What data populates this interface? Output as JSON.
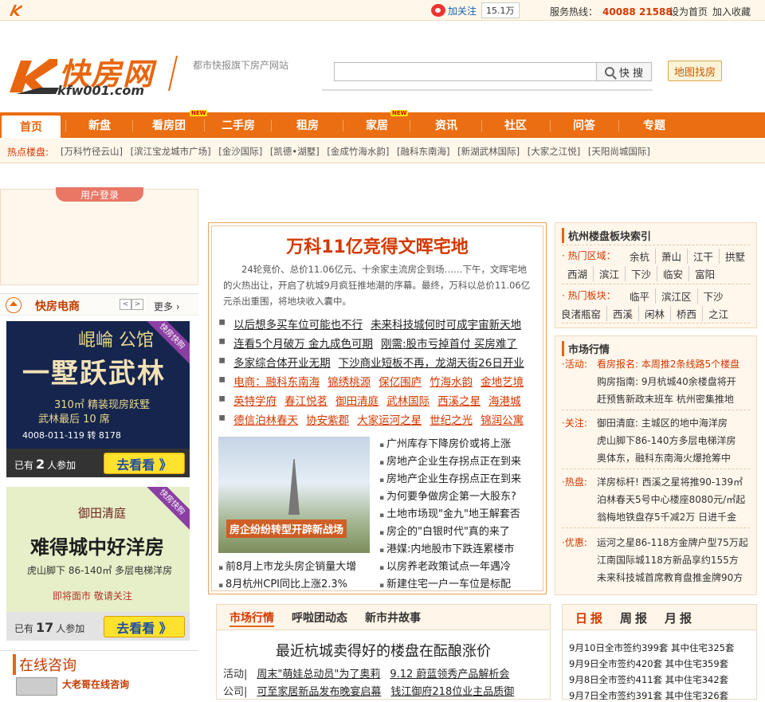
{
  "topbar": {
    "follow_label": "加关注",
    "follow_count": "15.1万",
    "hotline_label": "服务热线：",
    "hotline_number": "40088 21588",
    "home_link": "设为首页",
    "fav_link": "加入收藏"
  },
  "header": {
    "logo_cn": "快房网",
    "logo_en": "kfw001.com",
    "tagline": "都市快报旗下房产网站",
    "search_placeholder": "",
    "search_button": "快 搜",
    "map_button": "地图找房"
  },
  "nav": {
    "items": [
      "首页",
      "新盘",
      "看房团",
      "二手房",
      "租房",
      "家居",
      "资讯",
      "社区",
      "问答",
      "专题"
    ],
    "new_badge": "NEW"
  },
  "hotbar": {
    "label": "热点楼盘:",
    "items": [
      "[万科竹径云山]",
      "[滨江宝龙城市广场]",
      "[金沙国际]",
      "[凯德•湖墅]",
      "[金成竹海水韵]",
      "[融科东南海]",
      "[新湖武林国际]",
      "[大家之江悦]",
      "[天阳尚城国际]"
    ]
  },
  "left": {
    "login_tab": "用户登录",
    "ec_title": "快房电商",
    "ec_prev": "<",
    "ec_next": ">",
    "ec_more": "更多 ›",
    "ad1": {
      "ribbon": "快房快购",
      "t1": "崐崘 公馆",
      "t2": "一墅跃武林",
      "t3": "310㎡ 精装现房跃墅",
      "t4": "武林最后 10 席",
      "t5": "4008-011-119 转 8178",
      "joined_pre": "已有",
      "joined_num": "2",
      "joined_post": "人参加",
      "go": "去看看 》"
    },
    "ad2": {
      "ribbon": "快房快购",
      "t1": "御田清庭",
      "t2": "难得城中好洋房",
      "t3": "虎山脚下 86-140㎡ 多层电梯洋房",
      "t4": "即将面市  敬请关注",
      "joined_pre": "已有",
      "joined_num": "17",
      "joined_post": "人参加",
      "go": "去看看 》"
    },
    "consult_title": "在线咨询",
    "consult_sub": "大老哥在线咨询"
  },
  "featured": {
    "headline": "万科11亿竞得文晖宅地",
    "summary": "24轮竞价、总价11.06亿元、十余家主流房企到场……下午，文晖宅地的火热出让，开启了杭城9月疯狂推地潮的序幕。最终，万科以总价11.06亿元杀出重围，将地块收入囊中。",
    "lines": [
      [
        "以后想多买车位可能也不行",
        "未来科技城何时可成宇宙新天地"
      ],
      [
        "连看5个月破万 金九成色可期",
        "刚需:股市亏掉首付 买房难了"
      ],
      [
        "多家综合体开业无期",
        "下沙商业短板不再，龙湖天街26日开业"
      ]
    ],
    "red_lines": [
      [
        "电商：融科东南海",
        "锦绣桃源",
        "保亿围庐",
        "竹海水韵",
        "金地艺境"
      ],
      [
        "英特学府",
        "春江悦茗",
        "御田清庭",
        "武林国际",
        "西溪之星",
        "海港城"
      ],
      [
        "德信泊林春天",
        "协安紫郡",
        "大家运河之星",
        "世纪之光",
        "锦润公寓"
      ]
    ],
    "photo_caption": "房企纷纷转型开辟新战场",
    "right_news": [
      "广州库存下降房价或将上涨",
      "房地产企业生存拐点正在到来",
      "房地产企业生存拐点正在到来",
      "为何要争做房企第一大股东?",
      "土地市场现\"金九\"地王解套否",
      "房企的\"白银时代\"真的来了",
      "港媒:内地股市下跌连累楼市",
      "以房养老政策试点一年遇冷",
      "新建住宅一户一车位是标配"
    ],
    "bottom_news": [
      "前8月上市龙头房企销量大增",
      "8月杭州CPI同比上涨2.3%"
    ]
  },
  "index_box": {
    "title": "杭州楼盘板块索引",
    "hot_area_label": "· 热门区域：",
    "hot_area_row1": [
      "余杭",
      "萧山",
      "江干",
      "拱墅"
    ],
    "hot_area_row2": [
      "西湖",
      "滨江",
      "下沙",
      "临安",
      "富阳"
    ],
    "hot_block_label": "· 热门板块：",
    "hot_block_row1": [
      "临平",
      "滨江区",
      "下沙"
    ],
    "hot_block_row2": [
      "良渚瓶窑",
      "西溪",
      "闲林",
      "桥西",
      "之江"
    ]
  },
  "market_box": {
    "title": "市场行情",
    "activity_label": "·活动:",
    "activity_lines": [
      "看房报名: 本周推2条线路5个楼盘",
      "购房指南: 9月杭城40余楼盘将开",
      "赶预售新政末班车 杭州密集推地"
    ],
    "focus_label": "·关注:",
    "focus_lines": [
      "御田清庭: 主城区的地中海洋房",
      "虎山脚下86-140方多层电梯洋房",
      "奥体东，融科东南海火爆抢筹中"
    ],
    "hot_label": "·热盘:",
    "hot_lines": [
      "洋房标杆! 西溪之星将推90-139㎡",
      "泊林春天5号中心楼座8080元/㎡起",
      "翁梅地铁盘存5千减2万 日进千金"
    ],
    "deal_label": "·优惠:",
    "deal_lines": [
      "运河之星86-118方金牌户型75万起",
      "江南国际城118方新品享约155方",
      "未来科技城首席教育盘推金牌90方"
    ]
  },
  "tabs_box": {
    "tabs": [
      "市场行情",
      "呼啦团动态",
      "新市井故事"
    ],
    "headline": "最近杭城卖得好的楼盘在酝酿涨价",
    "lines": [
      {
        "cat": "活动|",
        "a": "周末\"萌娃总动员\"为了奥莉",
        "b": "9.12 蔚蓝领秀产品解析会"
      },
      {
        "cat": "公司|",
        "a": "可至家居新品发布晚宴启幕",
        "b": "钱江御府218位业主品质御"
      }
    ]
  },
  "daily_box": {
    "tabs": [
      "日报",
      "周报",
      "月报"
    ],
    "lines": [
      "9月10日全市签约399套  其中住宅325套",
      "9月9日全市签约420套  其中住宅359套",
      "9月8日全市签约411套  其中住宅342套",
      "9月7日全市签约391套  其中住宅326套"
    ]
  }
}
